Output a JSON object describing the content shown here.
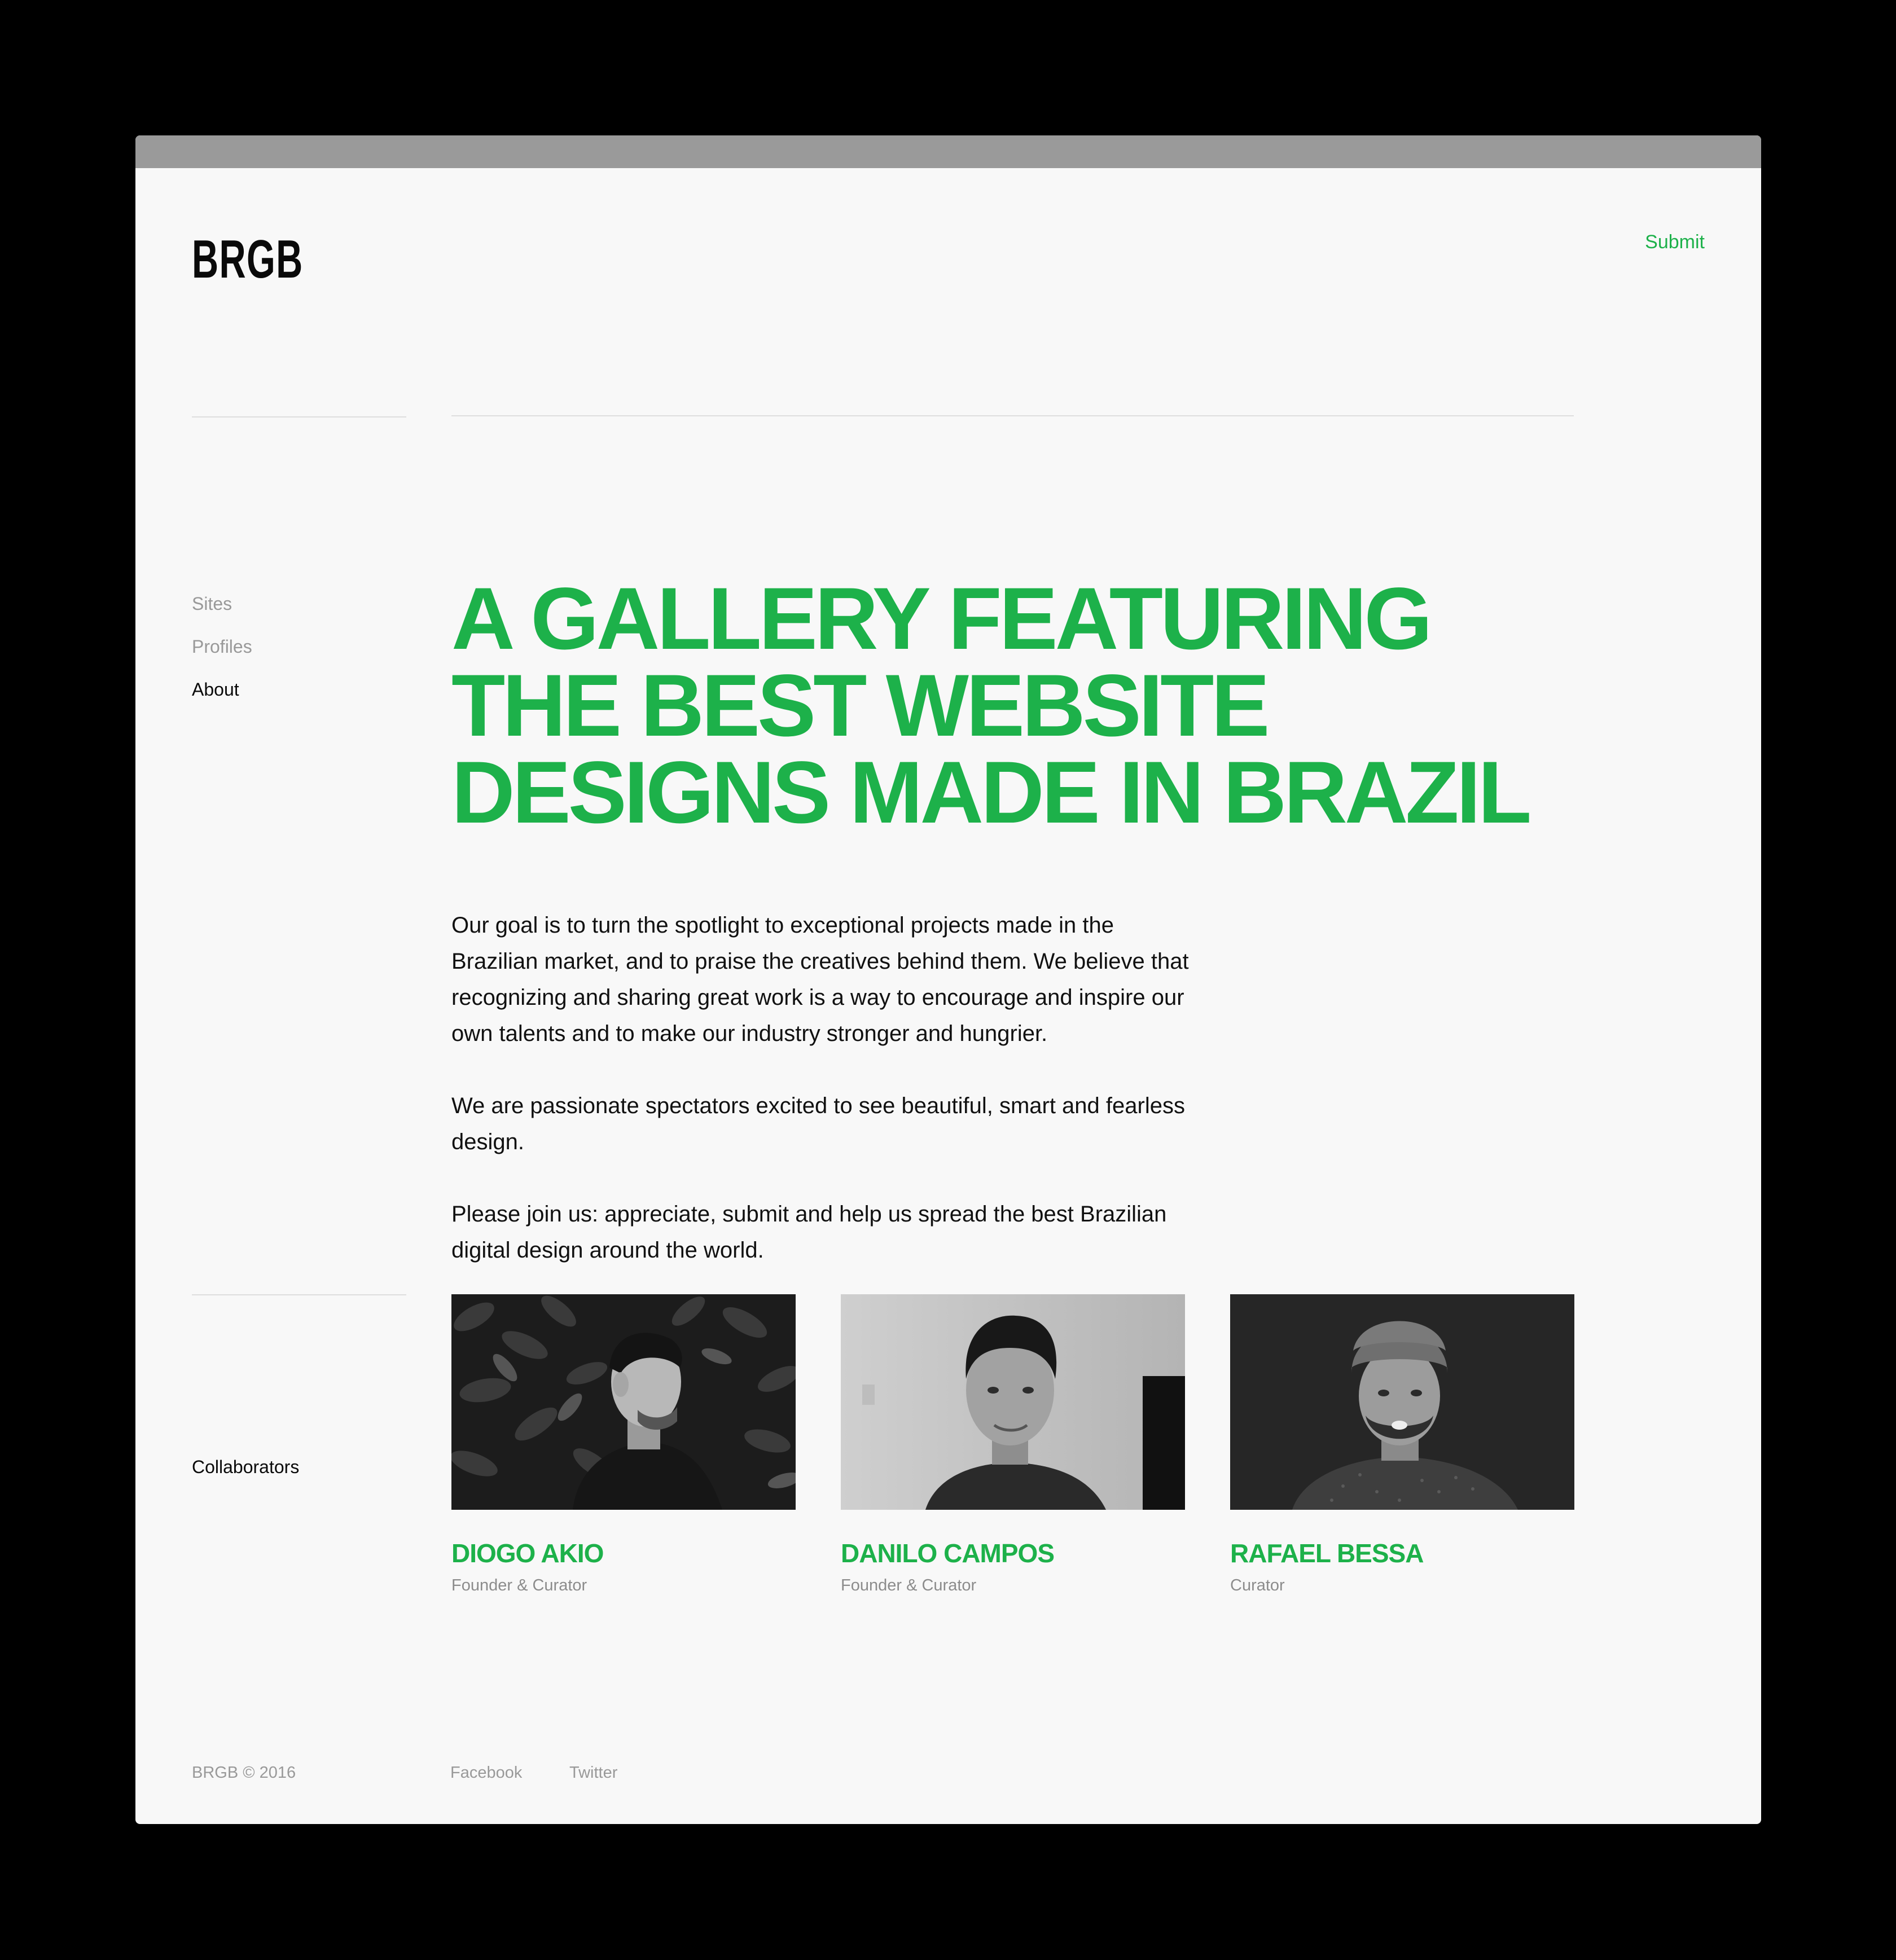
{
  "header": {
    "logo": "BRGB",
    "submit_label": "Submit"
  },
  "nav": {
    "items": [
      {
        "label": "Sites",
        "active": false
      },
      {
        "label": "Profiles",
        "active": false
      },
      {
        "label": "About",
        "active": true
      }
    ]
  },
  "hero": {
    "lines": [
      "A GALLERY FEATURING",
      "THE BEST WEBSITE",
      "DESIGNS MADE IN BRAZIL"
    ]
  },
  "intro": {
    "paragraphs": [
      "Our goal is to turn the spotlight to exceptional projects made in the Brazilian market, and to praise the creatives behind them. We believe that recognizing and sharing great work is a way to encourage and inspire our own talents and to make our industry stronger and hungrier.",
      "We are passionate spectators excited to see beautiful, smart and fearless design.",
      "Please join us: appreciate, submit and help us spread the best Brazilian digital design around the world."
    ]
  },
  "collaborators": {
    "label": "Collaborators",
    "people": [
      {
        "name": "DIOGO AKIO",
        "role": "Founder & Curator"
      },
      {
        "name": "DANILO CAMPOS",
        "role": "Founder & Curator"
      },
      {
        "name": "RAFAEL BESSA",
        "role": "Curator"
      }
    ]
  },
  "footer": {
    "copyright": "BRGB © 2016",
    "links": [
      "Facebook",
      "Twitter"
    ]
  },
  "colors": {
    "accent": "#1db14a",
    "background": "#f8f8f8",
    "titlebar": "#9a9a9a",
    "text": "#111111",
    "muted": "#999999"
  }
}
